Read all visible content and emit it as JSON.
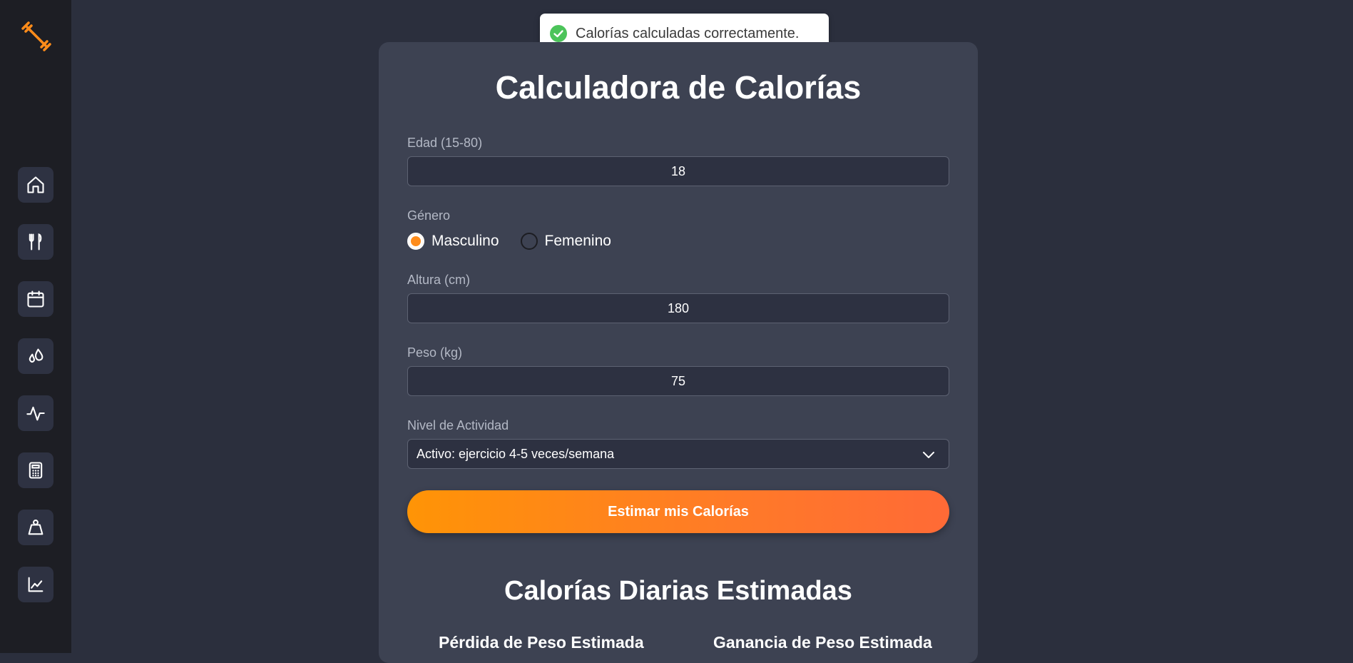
{
  "sidebar": {
    "logo_icon": "dumbbell-icon",
    "accent_color": "#ff8c1a",
    "items": [
      {
        "icon": "home-icon"
      },
      {
        "icon": "fork-knife-icon"
      },
      {
        "icon": "calendar-icon"
      },
      {
        "icon": "water-drops-icon"
      },
      {
        "icon": "activity-pulse-icon"
      },
      {
        "icon": "calculator-icon"
      },
      {
        "icon": "weight-scale-icon"
      },
      {
        "icon": "line-chart-icon"
      }
    ]
  },
  "toast": {
    "message": "Calorías calculadas correctamente.",
    "icon": "check-circle-icon",
    "color": "#4cc45a"
  },
  "form": {
    "title": "Calculadora de Calorías",
    "age": {
      "label": "Edad (15-80)",
      "value": "18"
    },
    "gender": {
      "label": "Género",
      "options": [
        {
          "label": "Masculino",
          "checked": true
        },
        {
          "label": "Femenino",
          "checked": false
        }
      ]
    },
    "height": {
      "label": "Altura (cm)",
      "value": "180"
    },
    "weight": {
      "label": "Peso (kg)",
      "value": "75"
    },
    "activity": {
      "label": "Nivel de Actividad",
      "value": "Activo: ejercicio 4-5 veces/semana"
    },
    "submit_label": "Estimar mis Calorías"
  },
  "results": {
    "title": "Calorías Diarias Estimadas",
    "loss_title": "Pérdida de Peso Estimada",
    "gain_title": "Ganancia de Peso Estimada"
  }
}
